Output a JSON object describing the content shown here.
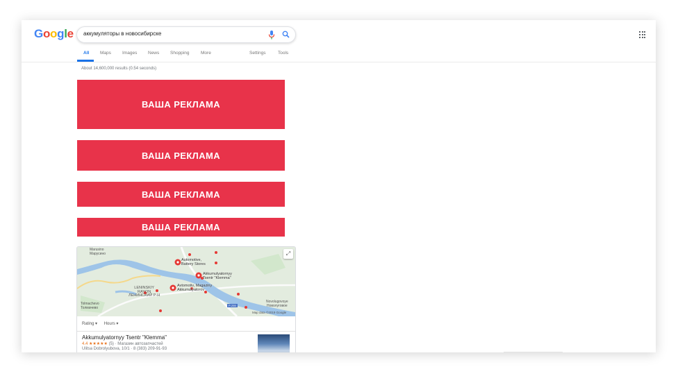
{
  "header": {
    "logo": {
      "letters": [
        "G",
        "o",
        "o",
        "g",
        "l",
        "e"
      ],
      "colors": [
        "#4285F4",
        "#EA4335",
        "#FBBC05",
        "#4285F4",
        "#34A853",
        "#EA4335"
      ]
    },
    "search": {
      "query": "аккумуляторы в новосибирске"
    },
    "tabs": [
      "All",
      "Maps",
      "Images",
      "News",
      "Shopping",
      "More"
    ],
    "tools": [
      "Settings",
      "Tools"
    ],
    "accent": "#1a73e8"
  },
  "results": {
    "stats": "About 14,600,000 results (0.54 seconds)"
  },
  "ads": [
    "ВАША РЕКЛАМА",
    "ВАША РЕКЛАМА",
    "ВАША РЕКЛАМА",
    "ВАША РЕКЛАМА"
  ],
  "ad_color": "#e8334a",
  "map": {
    "places": [
      "Marusino\nМарусино",
      "LENINSKIY\nRAYON\nЛЕНИНСКИЙ Р-Н",
      "Tolmachevo\nТолмачево",
      "Novolugovoye\nНоволуговое"
    ],
    "pins": [
      "Automotive,\nBattery Stores",
      "Akkumulyatornyy\nTsentr \"Klemma\"",
      "Avtomotiv, Magaziny\nAkkumulyatorov"
    ],
    "highway": "P-255",
    "attribution": "Map data ©2019 Google"
  },
  "filters": [
    "Rating ▾",
    "Hours ▾"
  ],
  "business": {
    "name": "Akkumulyatornyy Tsentr \"Klemma\"",
    "rating": "4.4",
    "stars": "★★★★★",
    "reviews": "(5)",
    "category": "Магазин автозапчастей",
    "address": "Ulitsa Dobrolyubova, 10/1 · 8 (383) 209-91-93"
  }
}
